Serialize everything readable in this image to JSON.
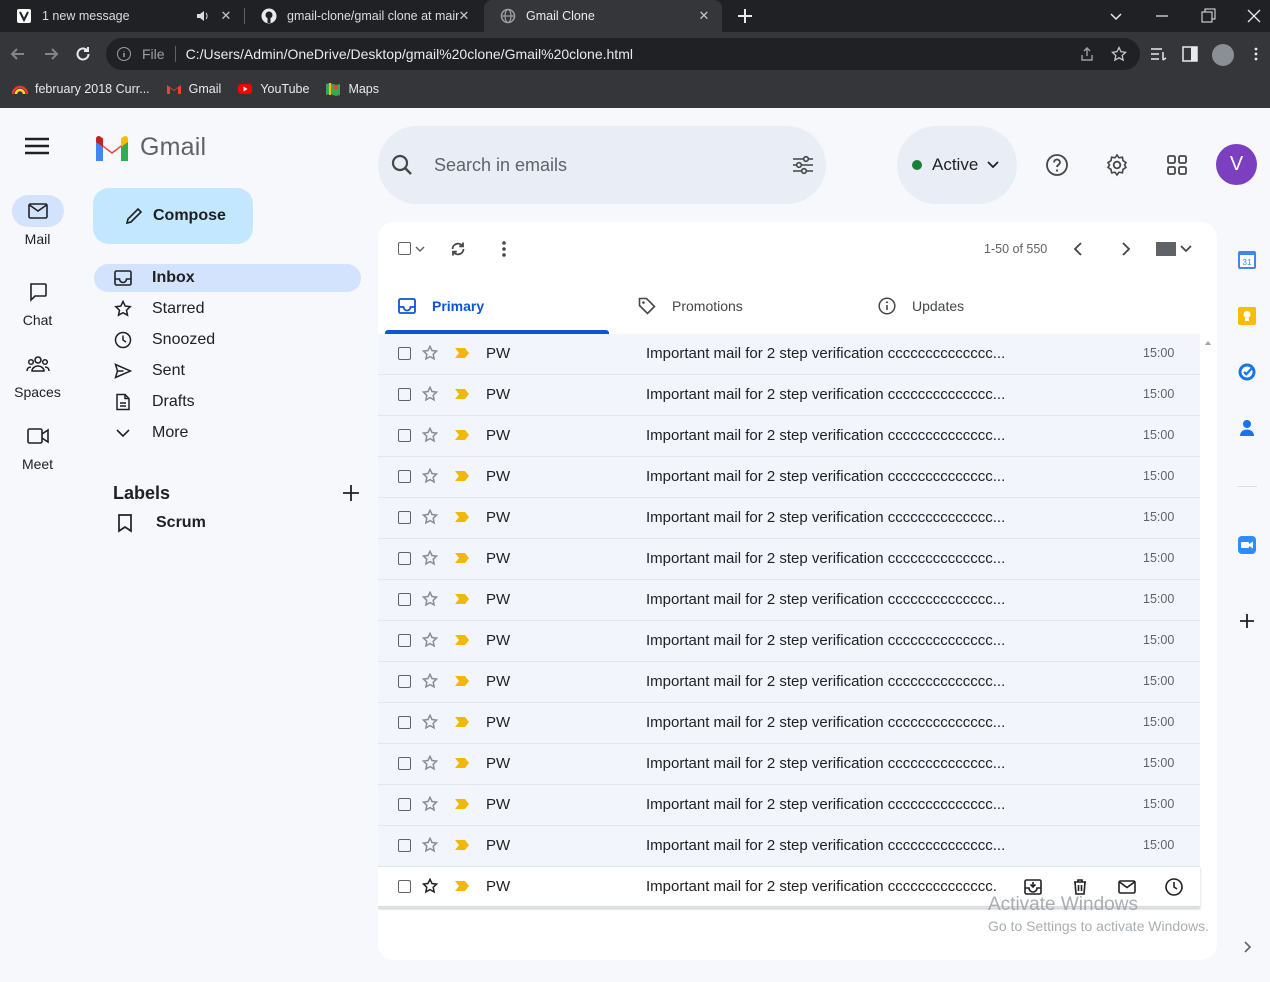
{
  "browser": {
    "tabs": [
      {
        "title": "1 new message",
        "active": false
      },
      {
        "title": "gmail-clone/gmail clone at main",
        "active": false
      },
      {
        "title": "Gmail Clone",
        "active": true
      }
    ],
    "address": {
      "scheme_label": "File",
      "url": "C:/Users/Admin/OneDrive/Desktop/gmail%20clone/Gmail%20clone.html"
    },
    "bookmarks": [
      {
        "label": "february 2018 Curr...",
        "icon": "rainbow-icon"
      },
      {
        "label": "Gmail",
        "icon": "gmail-icon"
      },
      {
        "label": "YouTube",
        "icon": "youtube-icon"
      },
      {
        "label": "Maps",
        "icon": "maps-icon"
      }
    ]
  },
  "app": {
    "logo_text": "Gmail",
    "rail": [
      {
        "label": "Mail",
        "icon": "mail-icon",
        "selected": true
      },
      {
        "label": "Chat",
        "icon": "chat-icon"
      },
      {
        "label": "Spaces",
        "icon": "spaces-icon"
      },
      {
        "label": "Meet",
        "icon": "meet-icon"
      }
    ],
    "compose_label": "Compose",
    "nav": [
      {
        "label": "Inbox",
        "icon": "inbox-icon",
        "selected": true
      },
      {
        "label": "Starred",
        "icon": "star-icon"
      },
      {
        "label": "Snoozed",
        "icon": "clock-icon"
      },
      {
        "label": "Sent",
        "icon": "send-icon"
      },
      {
        "label": "Drafts",
        "icon": "draft-icon"
      },
      {
        "label": "More",
        "icon": "chevron-down-icon"
      }
    ],
    "labels_heading": "Labels",
    "labels": [
      {
        "label": "Scrum",
        "icon": "bookmark-icon"
      }
    ],
    "search": {
      "placeholder": "Search in emails"
    },
    "status": {
      "label": "Active",
      "color": "#188038"
    },
    "avatar_letter": "V",
    "avatar_color": "#7b3fbf",
    "toolbar": {
      "pager": "1-50 of 550"
    },
    "tabs": [
      {
        "label": "Primary",
        "icon": "inbox-icon",
        "selected": true
      },
      {
        "label": "Promotions",
        "icon": "tag-icon"
      },
      {
        "label": "Updates",
        "icon": "info-icon"
      }
    ],
    "emails": [
      {
        "sender": "PW",
        "subject": "Important mail for 2 step verification cccccccccccccc...",
        "time": "15:00"
      },
      {
        "sender": "PW",
        "subject": "Important mail for 2 step verification cccccccccccccc...",
        "time": "15:00"
      },
      {
        "sender": "PW",
        "subject": "Important mail for 2 step verification cccccccccccccc...",
        "time": "15:00"
      },
      {
        "sender": "PW",
        "subject": "Important mail for 2 step verification cccccccccccccc...",
        "time": "15:00"
      },
      {
        "sender": "PW",
        "subject": "Important mail for 2 step verification cccccccccccccc...",
        "time": "15:00"
      },
      {
        "sender": "PW",
        "subject": "Important mail for 2 step verification cccccccccccccc...",
        "time": "15:00"
      },
      {
        "sender": "PW",
        "subject": "Important mail for 2 step verification cccccccccccccc...",
        "time": "15:00"
      },
      {
        "sender": "PW",
        "subject": "Important mail for 2 step verification cccccccccccccc...",
        "time": "15:00"
      },
      {
        "sender": "PW",
        "subject": "Important mail for 2 step verification cccccccccccccc...",
        "time": "15:00"
      },
      {
        "sender": "PW",
        "subject": "Important mail for 2 step verification cccccccccccccc...",
        "time": "15:00"
      },
      {
        "sender": "PW",
        "subject": "Important mail for 2 step verification cccccccccccccc...",
        "time": "15:00"
      },
      {
        "sender": "PW",
        "subject": "Important mail for 2 step verification cccccccccccccc...",
        "time": "15:00"
      },
      {
        "sender": "PW",
        "subject": "Important mail for 2 step verification cccccccccccccc...",
        "time": "15:00"
      },
      {
        "sender": "PW",
        "subject": "Important mail for 2 step verification cccccccccccccc.",
        "time": "",
        "hovered": true
      }
    ],
    "watermark": {
      "line1": "Activate Windows",
      "line2": "Go to Settings to activate Windows."
    },
    "colors": {
      "accent": "#0b57d0",
      "compose_bg": "#c2e7ff",
      "selected_bg": "#d3e3fd",
      "important": "#f2b807"
    }
  }
}
